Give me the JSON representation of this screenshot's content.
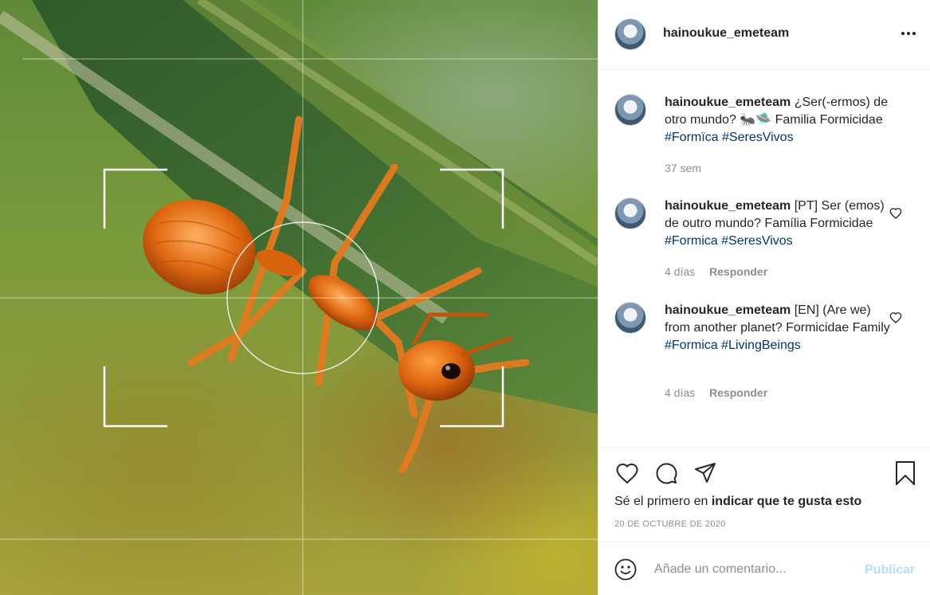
{
  "post": {
    "username": "hainoukue_emeteam",
    "avatar_icon": "avatar",
    "more_icon": "more-horizontal-icon"
  },
  "comments": [
    {
      "username": "hainoukue_emeteam",
      "text": "¿Ser(-ermos) de otro mundo? 🐜🛸 Familia Formicidae",
      "tags": [
        "#Formïca",
        "#SeresVivos"
      ],
      "time": "37 sem",
      "reply_label": ""
    },
    {
      "username": "hainoukue_emeteam",
      "text": "[PT] Ser (emos) de outro mundo? Família Formicidae",
      "tags": [
        "#Formica",
        "#SeresVivos"
      ],
      "time": "4 días",
      "reply_label": "Responder"
    },
    {
      "username": "hainoukue_emeteam",
      "text": "[EN] (Are we) from another planet? Formicidae Family",
      "tags": [
        "#Formica",
        "#LivingBeings"
      ],
      "time": "4 días",
      "reply_label": "Responder"
    }
  ],
  "actions": {
    "like_icon": "heart-icon",
    "comment_icon": "comment-icon",
    "share_icon": "share-icon",
    "save_icon": "bookmark-icon"
  },
  "likes": {
    "prefix": "Sé el primero en",
    "link": "indicar que te gusta esto"
  },
  "date": "20 DE OCTUBRE DE 2020",
  "add_comment": {
    "placeholder": "Añade un comentario...",
    "publish": "Publicar"
  },
  "colors": {
    "tag": "#00376b",
    "meta": "#8e8e8e",
    "publish_disabled": "#b2dffc"
  }
}
